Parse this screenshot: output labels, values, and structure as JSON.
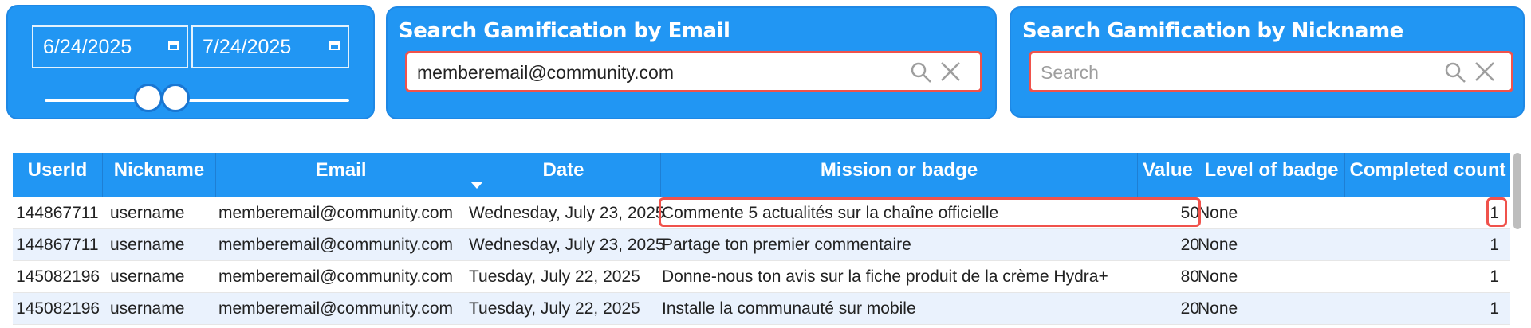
{
  "date_filter": {
    "start_date": "6/24/2025",
    "end_date": "7/24/2025"
  },
  "email_search": {
    "title": "Search Gamification by Email",
    "value": "memberemail@community.com",
    "placeholder": "Search"
  },
  "nickname_search": {
    "title": "Search Gamification by Nickname",
    "value": "",
    "placeholder": "Search"
  },
  "table": {
    "headers": {
      "userid": "UserId",
      "nickname": "Nickname",
      "email": "Email",
      "date": "Date",
      "mission": "Mission or badge",
      "value": "Value",
      "level": "Level of badge",
      "count": "Completed count"
    },
    "sorted_column": "Date",
    "rows": [
      {
        "userid": "144867711",
        "nickname": "username",
        "email": "memberemail@community.com",
        "date": "Wednesday, July 23, 2025",
        "mission": "Commente 5 actualités sur la chaîne officielle",
        "value": "50",
        "level": "None",
        "count": "1"
      },
      {
        "userid": "144867711",
        "nickname": "username",
        "email": "memberemail@community.com",
        "date": "Wednesday, July 23, 2025",
        "mission": "Partage ton premier commentaire",
        "value": "20",
        "level": "None",
        "count": "1"
      },
      {
        "userid": "145082196",
        "nickname": "username",
        "email": "memberemail@community.com",
        "date": "Tuesday, July 22, 2025",
        "mission": "Donne-nous ton avis sur la fiche produit de la crème Hydra+",
        "value": "80",
        "level": "None",
        "count": "1"
      },
      {
        "userid": "145082196",
        "nickname": "username",
        "email": "memberemail@community.com",
        "date": "Tuesday, July 22, 2025",
        "mission": "Installe la communauté sur mobile",
        "value": "20",
        "level": "None",
        "count": "1"
      }
    ]
  },
  "colors": {
    "accent": "#2196f3",
    "highlight": "#f0524b",
    "alt_row": "#eaf2fd"
  },
  "icons": [
    "calendar-icon",
    "search-icon",
    "clear-icon",
    "sort-desc-icon"
  ]
}
